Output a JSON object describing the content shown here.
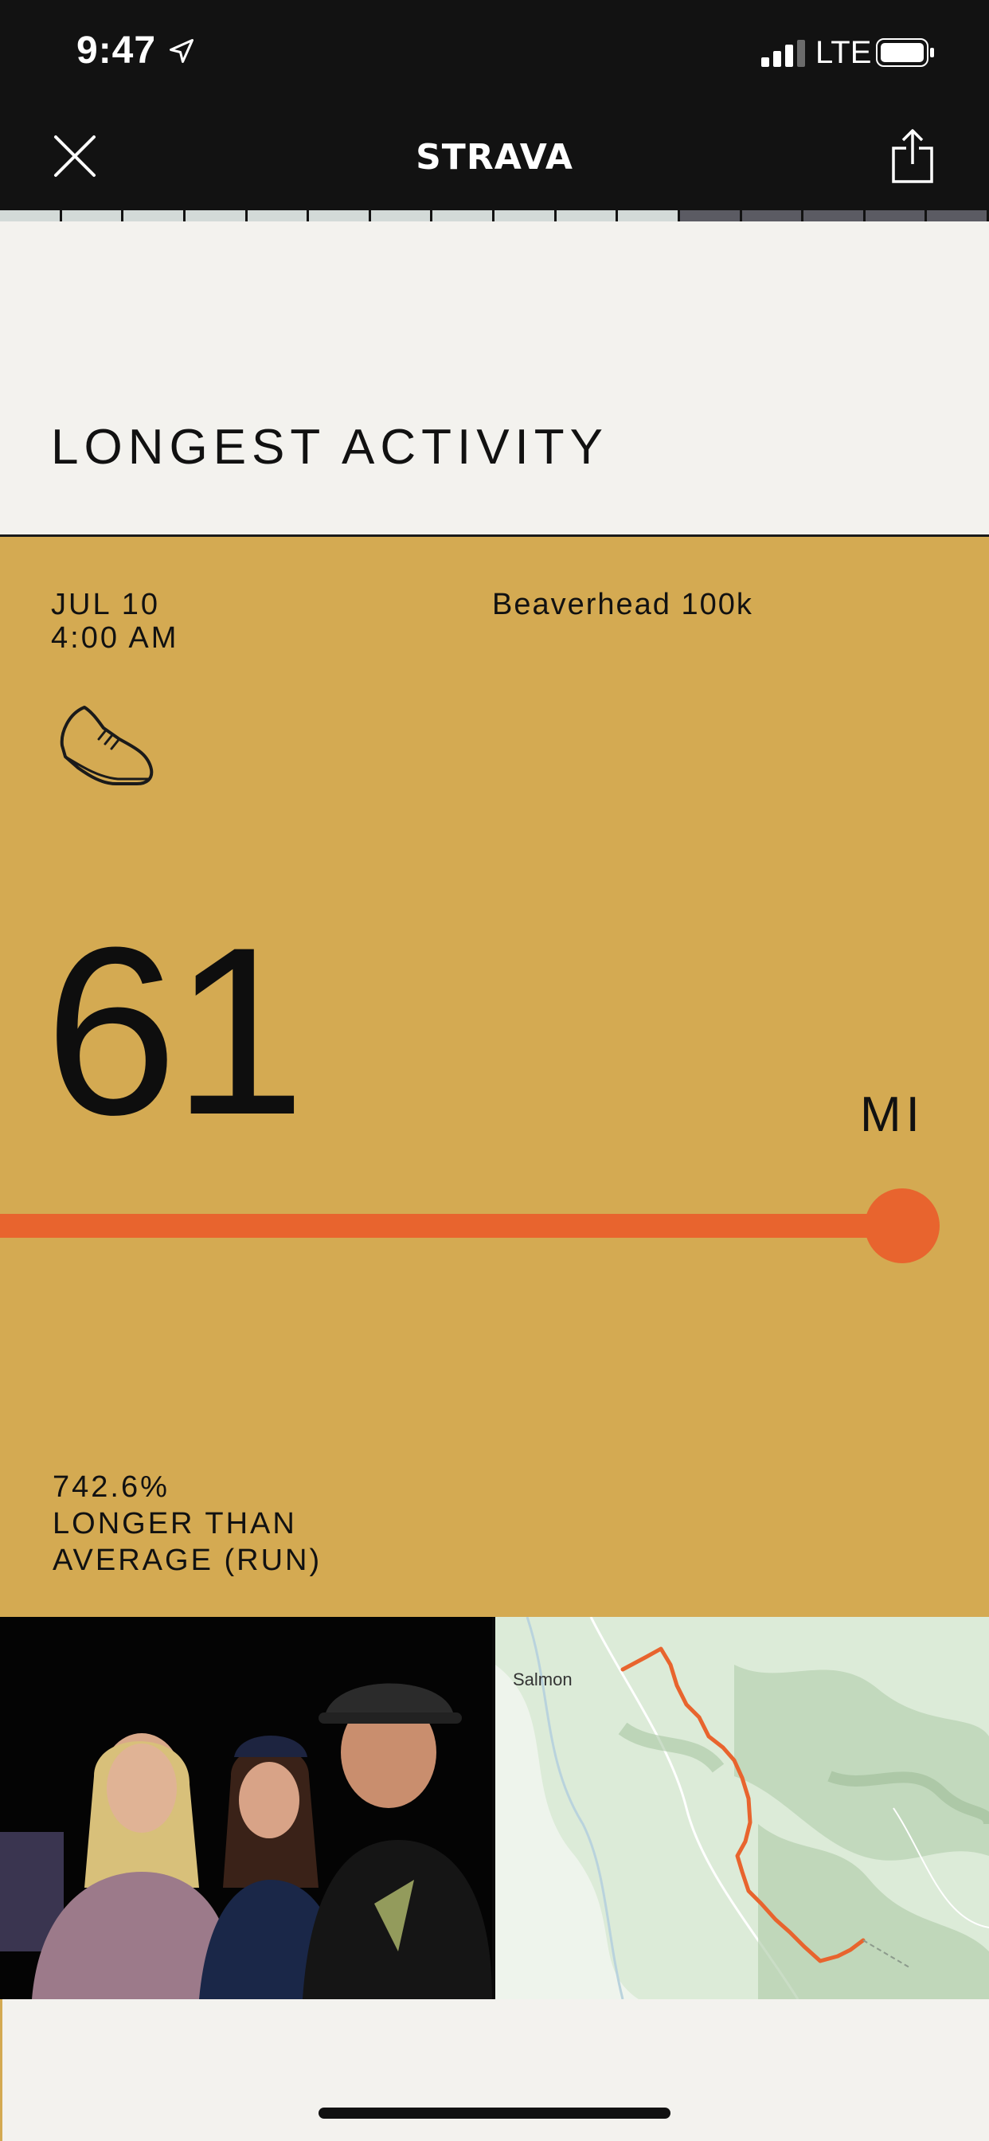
{
  "status_bar": {
    "time": "9:47",
    "carrier": "LTE",
    "location_icon": "location-arrow-icon",
    "signal_icon": "signal-icon",
    "battery_icon": "battery-icon"
  },
  "nav": {
    "logo": "STRAVA",
    "close_icon": "close-icon",
    "share_icon": "share-icon"
  },
  "progress": {
    "total_segments": 16,
    "completed_segments": 11,
    "completed_color": "#d3dad8",
    "remaining_color": "#5b5b63"
  },
  "page": {
    "title": "LONGEST ACTIVITY"
  },
  "activity": {
    "date": "JUL 10",
    "time": "4:00 AM",
    "name": "Beaverhead 100k",
    "sport_icon": "running-shoe-icon",
    "distance": "61",
    "unit": "MI",
    "distance_fill_fraction": 1.0,
    "stat_value": "742.6%",
    "stat_line1": "LONGER THAN",
    "stat_line2": "AVERAGE (RUN)"
  },
  "map": {
    "place_label": "Salmon"
  },
  "colors": {
    "card_bg": "#d4aa52",
    "accent": "#e8642e",
    "dark": "#121212",
    "page_bg": "#f3f2ee"
  }
}
